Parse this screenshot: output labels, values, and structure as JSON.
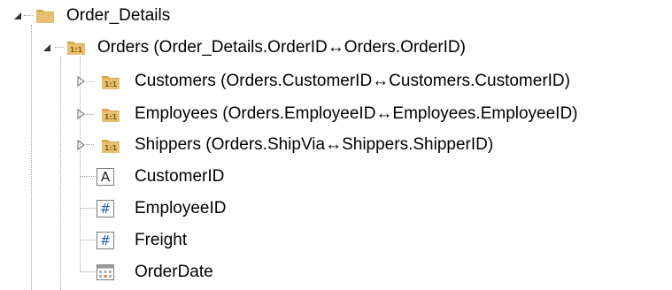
{
  "tree": {
    "root": {
      "label": "Order_Details"
    },
    "orders": {
      "label": "Orders (Order_Details.OrderID↔Orders.OrderID)",
      "badge": "1:1"
    },
    "customers": {
      "label": "Customers (Orders.CustomerID↔Customers.CustomerID)",
      "badge": "1:1"
    },
    "employees": {
      "label": "Employees (Orders.EmployeeID↔Employees.EmployeeID)",
      "badge": "1:1"
    },
    "shippers": {
      "label": "Shippers (Orders.ShipVia↔Shippers.ShipperID)",
      "badge": "1:1"
    },
    "fields": [
      {
        "label": "CustomerID",
        "type_glyph": "A",
        "icon": "text-field-icon"
      },
      {
        "label": "EmployeeID",
        "type_glyph": "#",
        "icon": "number-field-icon"
      },
      {
        "label": "Freight",
        "type_glyph": "#",
        "icon": "number-field-icon"
      },
      {
        "label": "OrderDate",
        "type_glyph": "",
        "icon": "date-field-icon"
      }
    ]
  },
  "colors": {
    "folder": "#e8c072",
    "folder_dark": "#d9a94e",
    "badge_text": "#8a5a10",
    "number_glyph": "#2a63b8",
    "tree_line": "#a0a0a0"
  }
}
